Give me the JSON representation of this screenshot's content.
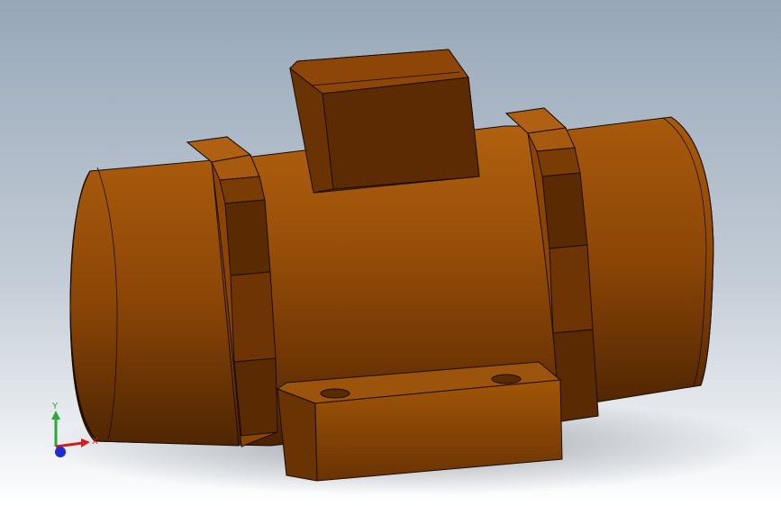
{
  "viewport": {
    "background_top": "#9aa9b9",
    "background_bottom": "#ffffff"
  },
  "model": {
    "part": "vibration-motor",
    "body_color": "#8a4505",
    "body_light": "#b3600e",
    "body_dark": "#4a2203",
    "edge_color": "#1a0c00"
  },
  "triad": {
    "x_label": "X",
    "y_label": "Y",
    "x_color": "#d21e1e",
    "y_color": "#2aa83a",
    "z_color": "#1e2ad2"
  }
}
